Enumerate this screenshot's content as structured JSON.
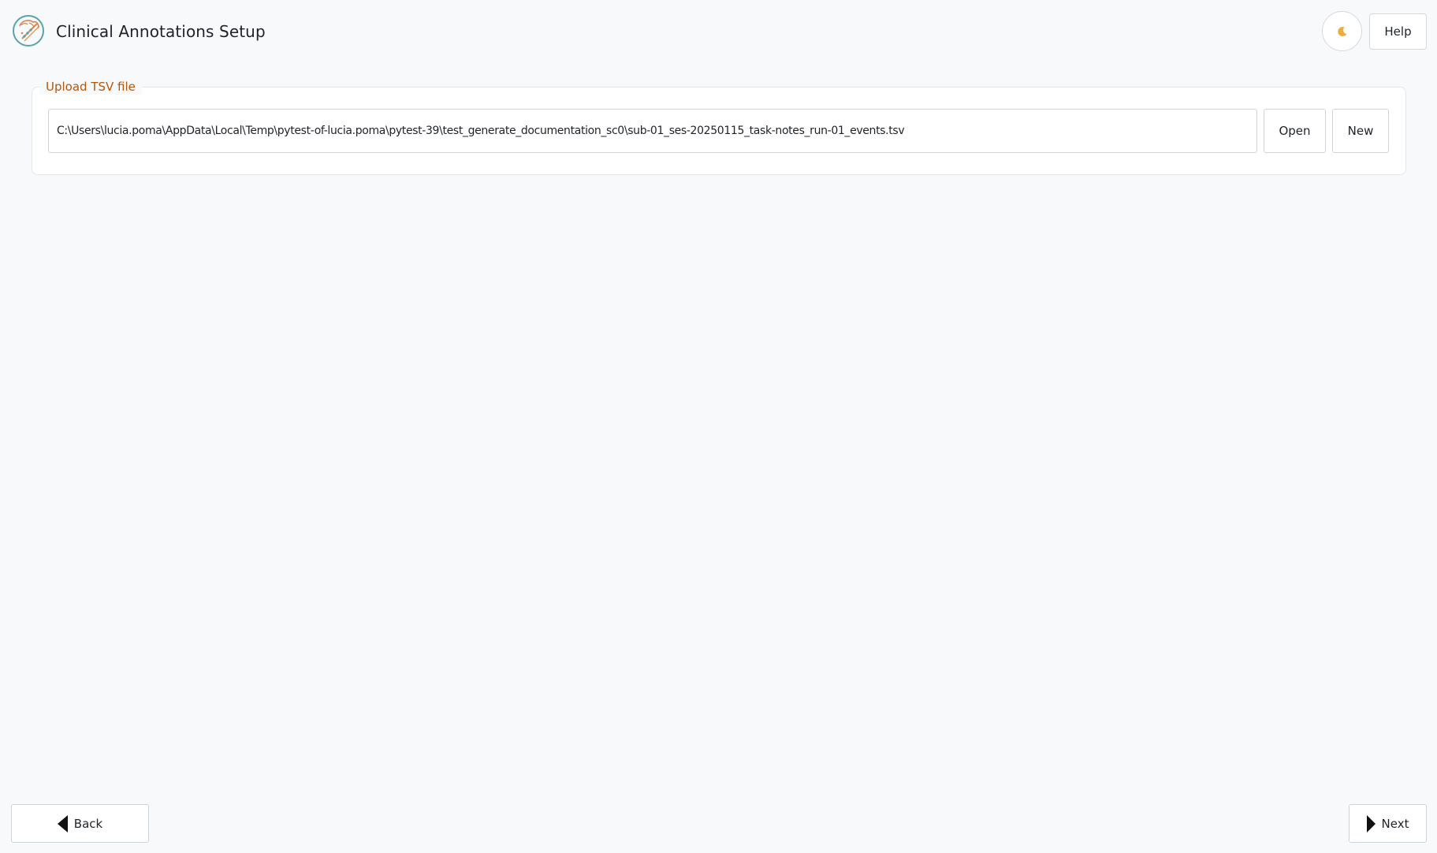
{
  "header": {
    "title": "Clinical Annotations Setup",
    "logo_icon": "brain-electrodes-logo",
    "theme_toggle_icon": "moon-icon",
    "help_label": "Help"
  },
  "upload": {
    "legend": "Upload TSV file",
    "path_value": "C:\\Users\\lucia.poma\\AppData\\Local\\Temp\\pytest-of-lucia.poma\\pytest-39\\test_generate_documentation_sc0\\sub-01_ses-20250115_task-notes_run-01_events.tsv",
    "open_label": "Open",
    "new_label": "New"
  },
  "footer": {
    "back_label": "Back",
    "next_label": "Next",
    "back_icon": "triangle-left-icon",
    "next_icon": "triangle-right-icon"
  },
  "colors": {
    "background": "#f7f9fb",
    "legend_accent": "#b4560d",
    "logo_orange": "#d9874a",
    "logo_teal": "#5aa3a8"
  }
}
